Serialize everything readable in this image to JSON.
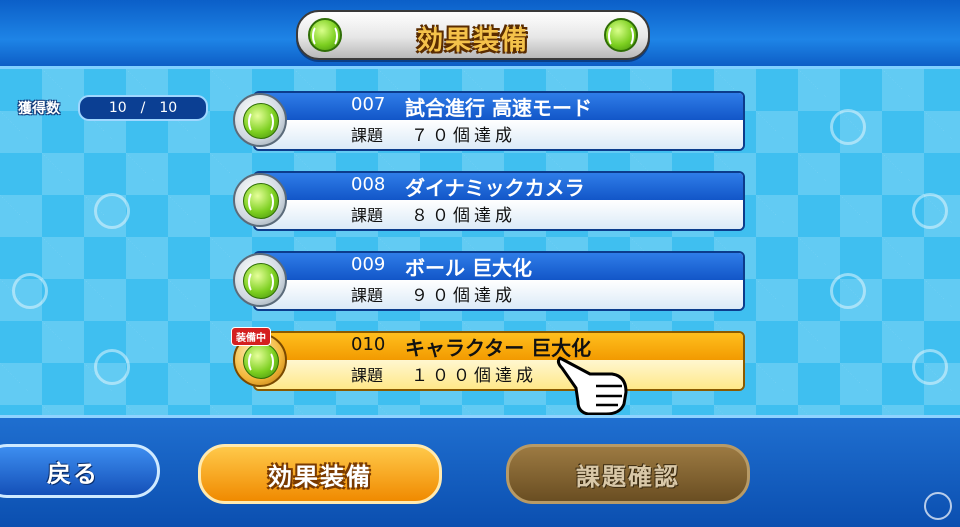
{
  "header": {
    "title": "効果装備"
  },
  "counter": {
    "label": "獲得数",
    "current": "10",
    "separator": "/",
    "total": "10"
  },
  "items": [
    {
      "code": "007",
      "name": "試合進行 高速モード",
      "req_label": "課題",
      "req_text": "７０個達成",
      "equipped": false
    },
    {
      "code": "008",
      "name": "ダイナミックカメラ",
      "req_label": "課題",
      "req_text": "８０個達成",
      "equipped": false
    },
    {
      "code": "009",
      "name": "ボール 巨大化",
      "req_label": "課題",
      "req_text": "９０個達成",
      "equipped": false
    },
    {
      "code": "010",
      "name": "キャラクター 巨大化",
      "req_label": "課題",
      "req_text": "１００個達成",
      "equipped": true,
      "badge": "装備中"
    }
  ],
  "buttons": {
    "back": "戻る",
    "equip": "効果装備",
    "check": "課題確認"
  },
  "colors": {
    "accent_blue": "#1256c8",
    "equipped_orange": "#f29a00",
    "field": "#3fbff0"
  },
  "icons": {
    "header": "tennis-ball-icon",
    "medal": "tennis-ball-medal-icon",
    "pointer": "pointing-hand-icon"
  }
}
